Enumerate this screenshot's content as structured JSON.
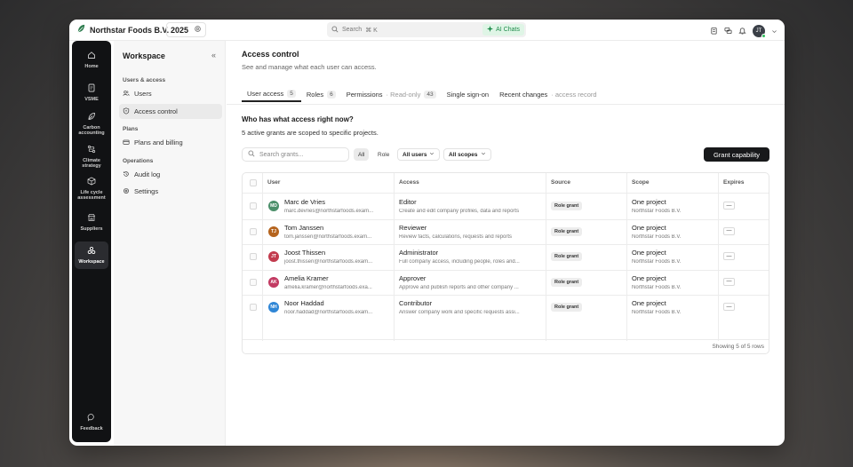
{
  "topbar": {
    "company": "Northstar Foods B.V.",
    "year": "2025",
    "search_placeholder": "Search",
    "search_shortcut": "⌘ K",
    "ai_chat_label": "AI Chats",
    "user_initials": "JT"
  },
  "rail": {
    "items": [
      {
        "label": "Home"
      },
      {
        "label": "VSME"
      },
      {
        "label": "Carbon accounting"
      },
      {
        "label": "Climate strategy"
      },
      {
        "label": "Life cycle assessment"
      },
      {
        "label": "Suppliers"
      },
      {
        "label": "Workspace"
      }
    ],
    "feedback": "Feedback"
  },
  "sidebar": {
    "title": "Workspace",
    "collapse": "«",
    "sections": [
      {
        "label": "Users & access",
        "items": [
          {
            "label": "Users"
          },
          {
            "label": "Access control"
          }
        ]
      },
      {
        "label": "Plans",
        "items": [
          {
            "label": "Plans and billing"
          }
        ]
      },
      {
        "label": "Operations",
        "items": [
          {
            "label": "Audit log"
          },
          {
            "label": "Settings"
          }
        ]
      }
    ]
  },
  "main": {
    "title": "Access control",
    "subtitle": "See and manage what each user can access.",
    "tabs": [
      {
        "label": "User access",
        "count": "5"
      },
      {
        "label": "Roles",
        "count": "6"
      },
      {
        "label": "Permissions",
        "note": "· Read-only",
        "count": "43"
      },
      {
        "label": "Single sign-on"
      },
      {
        "label": "Recent changes",
        "note": "· access record"
      }
    ],
    "question": "Who has what access right now?",
    "summary": "5 active grants are scoped to specific projects.",
    "grant_search_placeholder": "Search grants...",
    "filter_all": "All",
    "filter_role": "Role",
    "filter_users": "All users",
    "filter_scopes": "All scopes",
    "grant_button": "Grant capability"
  },
  "table": {
    "headers": {
      "user": "User",
      "access": "Access",
      "source": "Source",
      "scope": "Scope",
      "expires": "Expires"
    },
    "rows": [
      {
        "initials": "MD",
        "avatar_color": "#4b8f6a",
        "name": "Marc de Vries",
        "email": "marc.devries@northstarfoods.exam...",
        "access": "Editor",
        "access_desc": "Create and edit company profiles, data and reports",
        "source": "Role grant",
        "scope": "One project",
        "scope_sub": "Northstar Foods B.V.",
        "expires": "—"
      },
      {
        "initials": "TJ",
        "avatar_color": "#b5641e",
        "name": "Tom Janssen",
        "email": "tom.janssen@northstarfoods.exam...",
        "access": "Reviewer",
        "access_desc": "Review facts, calculations, requests and reports",
        "source": "Role grant",
        "scope": "One project",
        "scope_sub": "Northstar Foods B.V.",
        "expires": "—"
      },
      {
        "initials": "JT",
        "avatar_color": "#c23a4d",
        "name": "Joost Thissen",
        "email": "joost.thissen@northstarfoods.exam...",
        "access": "Administrator",
        "access_desc": "Full company access, including people, roles and...",
        "source": "Role grant",
        "scope": "One project",
        "scope_sub": "Northstar Foods B.V.",
        "expires": "—"
      },
      {
        "initials": "AK",
        "avatar_color": "#c23a62",
        "name": "Amelia Kramer",
        "email": "amelia.kramer@northstarfoods.exa...",
        "access": "Approver",
        "access_desc": "Approve and publish reports and other company ...",
        "source": "Role grant",
        "scope": "One project",
        "scope_sub": "Northstar Foods B.V.",
        "expires": "—"
      },
      {
        "initials": "NH",
        "avatar_color": "#2f86d6",
        "name": "Noor Haddad",
        "email": "noor.haddad@northstarfoods.exam...",
        "access": "Contributor",
        "access_desc": "Answer company work and specific requests assi...",
        "source": "Role grant",
        "scope": "One project",
        "scope_sub": "Northstar Foods B.V.",
        "expires": "—"
      }
    ],
    "footer": "Showing 5 of 5 rows"
  }
}
